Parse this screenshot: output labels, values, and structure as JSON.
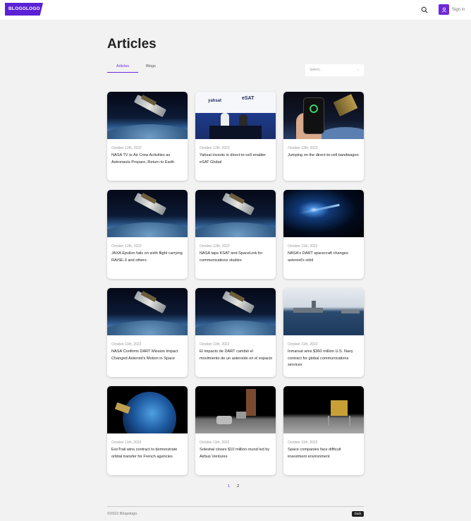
{
  "header": {
    "logo": "BLOGOLOGO",
    "search_icon": "search-icon",
    "signin_icon": "user-icon",
    "signin_label": "Sign in"
  },
  "main": {
    "title": "Articles",
    "tabs": [
      {
        "label": "Articles",
        "active": true
      },
      {
        "label": "Blogs",
        "active": false
      }
    ],
    "sort_select": {
      "placeholder": "Select...",
      "icon": "chevron-down-icon"
    }
  },
  "articles": [
    {
      "date": "October 12th, 2022",
      "title": "NASA TV to Air Crew Activities as Astronauts Prepare, Return to Earth"
    },
    {
      "date": "October 12th, 2022",
      "title": "Yahsat invests in direct-to-cell enabler eSAT Global"
    },
    {
      "date": "October 12th, 2022",
      "title": "Jumping on the direct-to-cell bandwagon"
    },
    {
      "date": "October 12th, 2022",
      "title": "JAXA Epsilon fails on sixth flight carrying RAISE-3 and others"
    },
    {
      "date": "October 12th, 2022",
      "title": "NASA taps KSAT and SpaceLink for communications studies"
    },
    {
      "date": "October 11th, 2022",
      "title": "NASA's DART spacecraft changes asteroid's orbit"
    },
    {
      "date": "October 11th, 2022",
      "title": "NASA Confirms DART Mission Impact Changed Asteroid's Motion in Space"
    },
    {
      "date": "October 11th, 2022",
      "title": "El impacto de DART cambió el movimiento de un asteroide en el espacio"
    },
    {
      "date": "October 11th, 2022",
      "title": "Inmarsat wins $360 million U.S. Navy contract for global communications services"
    },
    {
      "date": "October 11th, 2022",
      "title": "ExoTrail wins contract to demonstrate orbital transfer for French agencies"
    },
    {
      "date": "October 11th, 2022",
      "title": "Solestial closes $10 million round led by Airbus Ventures"
    },
    {
      "date": "October 11th, 2022",
      "title": "Space companies face difficult investment environment"
    }
  ],
  "thumb_labels": {
    "yahsat": "yahsat",
    "esat": "eSAT"
  },
  "pagination": {
    "pages": [
      "1",
      "2"
    ],
    "current": "1"
  },
  "footer": {
    "copyright": "©2022 Blogologo",
    "theme_toggle": "Dark"
  },
  "colors": {
    "accent": "#6d28d9",
    "logo_bg": "#5b21d4",
    "page_bg": "#f2f2f2"
  }
}
